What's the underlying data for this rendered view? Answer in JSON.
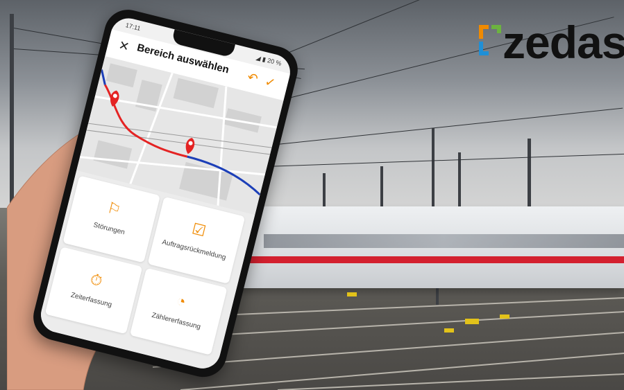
{
  "brand": {
    "name": "zedas",
    "mark_colors": [
      "#f08a00",
      "#1f8fd6",
      "#6cb33f",
      "#e41e26"
    ]
  },
  "phone": {
    "status_time": "17:11",
    "status_right": "◢ ▮ 20 %",
    "title": "Bereich auswählen",
    "close_icon": "close-icon",
    "undo_icon": "undo-icon",
    "confirm_icon": "check-icon",
    "accent_color": "#f08a00",
    "route_colors": {
      "selected": "#e42323",
      "unselected": "#1c3fb8"
    },
    "tiles": [
      {
        "label": "Störungen",
        "icon": "flag-icon"
      },
      {
        "label": "Auftragsrückmeldung",
        "icon": "clipboard-check-icon"
      },
      {
        "label": "Zeiterfassung",
        "icon": "stopwatch-icon"
      },
      {
        "label": "Zählererfassung",
        "icon": "gauge-icon"
      }
    ]
  }
}
